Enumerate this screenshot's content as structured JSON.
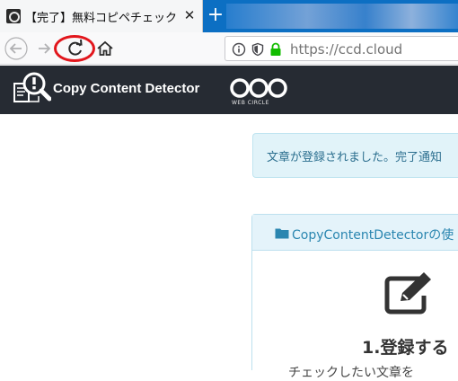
{
  "browser": {
    "tab_title": "【完了】無料コピペチェックツ",
    "tab_close": "✕",
    "new_tab": "+",
    "url": "https://ccd.cloud"
  },
  "site": {
    "brand": "Copy Content Detector",
    "partner_label": "WEB CIRCLE"
  },
  "content": {
    "alert_text": "文章が登録されました。完了通知",
    "panel_title": "CopyContentDetectorの使",
    "step_title": "1.登録する",
    "partial_line": "チェックしたい文章を"
  },
  "colors": {
    "tabstrip": "#0c6fc3",
    "header": "#262b33",
    "secure_lock": "#12bc00",
    "annotation_circle": "#e2161c",
    "alert_bg": "#e1f3f9",
    "panel_accent": "#2a86b0"
  }
}
